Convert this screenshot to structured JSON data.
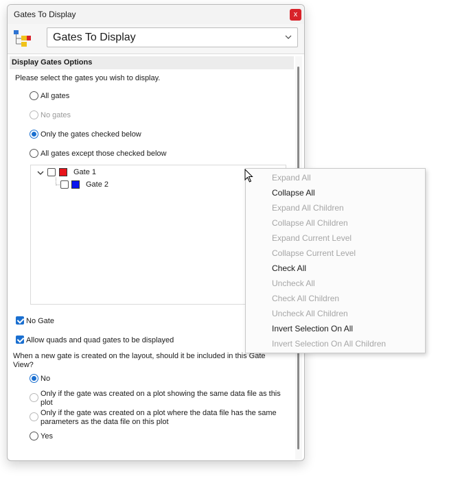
{
  "window": {
    "title": "Gates To Display",
    "close_glyph": "x"
  },
  "header": {
    "icon": "gate-hierarchy-icon",
    "selected_view": "Gates To Display"
  },
  "section": {
    "title": "Display Gates Options",
    "instruction": "Please select the gates you wish to display."
  },
  "display_options": [
    {
      "label": "All gates",
      "checked": false,
      "enabled": true
    },
    {
      "label": "No gates",
      "checked": false,
      "enabled": false
    },
    {
      "label": "Only the gates checked below",
      "checked": true,
      "enabled": true
    },
    {
      "label": "All gates except those checked below",
      "checked": false,
      "enabled": true
    }
  ],
  "tree": {
    "items": [
      {
        "label": "Gate 1",
        "color": "#e8141b",
        "checked": false,
        "expanded": true
      },
      {
        "label": "Gate 2",
        "color": "#0a14ee",
        "checked": false
      }
    ]
  },
  "checkboxes": {
    "no_gate": {
      "label": "No Gate",
      "checked": true
    },
    "allow_quads": {
      "label": "Allow quads and quad gates to be displayed",
      "checked": true
    }
  },
  "new_gate": {
    "question": "When a new gate is created on the layout, should it be included in this Gate View?",
    "options": [
      {
        "label": "No",
        "checked": true,
        "enabled": true
      },
      {
        "label": "Only if the gate was created on a plot showing the same data file as this plot",
        "checked": false,
        "enabled": false
      },
      {
        "label": "Only if the gate was created on a plot where the data file has the same parameters as the data file on this plot",
        "checked": false,
        "enabled": false
      },
      {
        "label": "Yes",
        "checked": false,
        "enabled": true
      }
    ]
  },
  "context_menu": {
    "items": [
      {
        "label": "Expand All",
        "enabled": false
      },
      {
        "label": "Collapse All",
        "enabled": true
      },
      {
        "label": "Expand All Children",
        "enabled": false
      },
      {
        "label": "Collapse All Children",
        "enabled": false
      },
      {
        "label": "Expand Current Level",
        "enabled": false
      },
      {
        "label": "Collapse Current Level",
        "enabled": false
      },
      {
        "label": "Check All",
        "enabled": true
      },
      {
        "label": "Uncheck All",
        "enabled": false
      },
      {
        "label": "Check All Children",
        "enabled": false
      },
      {
        "label": "Uncheck All Children",
        "enabled": false
      },
      {
        "label": "Invert Selection On All",
        "enabled": true
      },
      {
        "label": "Invert Selection On All Children",
        "enabled": false
      }
    ]
  },
  "colors": {
    "accent": "#1a6fd0",
    "close_button": "#d8232a"
  }
}
